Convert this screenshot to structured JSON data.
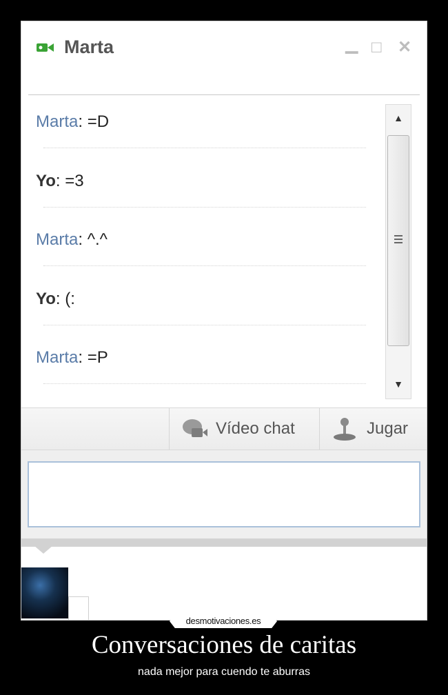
{
  "window": {
    "title": "Marta",
    "icons": {
      "camera": "video-camera-icon",
      "minimize": "minimize-icon",
      "maximize": "maximize-icon",
      "close": "close-icon"
    }
  },
  "messages": [
    {
      "sender": "Marta",
      "separator": ":",
      "text": " =D"
    },
    {
      "sender": "Yo",
      "separator": ":",
      "text": " =3"
    },
    {
      "sender": "Marta",
      "separator": ":",
      "text": " ^.^"
    },
    {
      "sender": "Yo",
      "separator": ":",
      "text": " (:"
    },
    {
      "sender": "Marta",
      "separator": ":",
      "text": " =P"
    }
  ],
  "toolbar": {
    "video_chat_label": "Vídeo chat",
    "jugar_label": "Jugar"
  },
  "chat_input": {
    "value": ""
  },
  "poster": {
    "watermark": "desmotivaciones.es",
    "title": "Conversaciones de caritas",
    "subtitle": "nada mejor para cuendo te aburras"
  },
  "colors": {
    "sender_marta": "#5a7ca8",
    "camera_green": "#3aa335",
    "input_border": "#a9c0da",
    "poster_bg": "#000000"
  }
}
